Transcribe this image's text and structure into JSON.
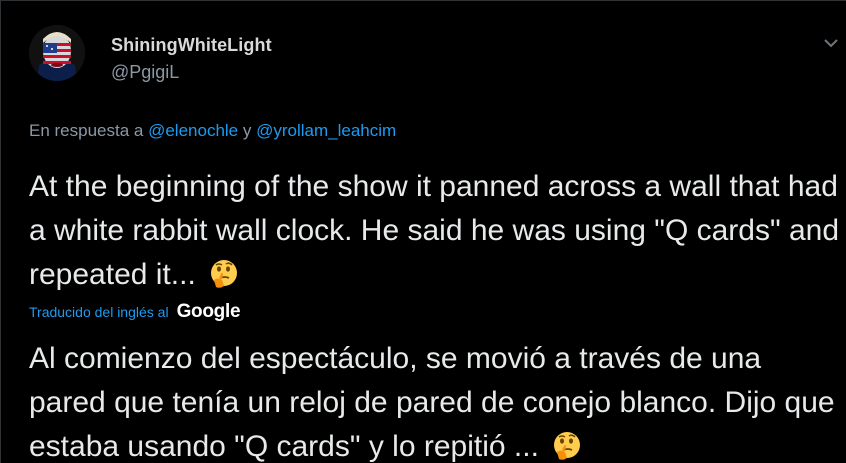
{
  "tweet": {
    "author": {
      "display_name": "ShiningWhiteLight",
      "handle": "@PgigiL"
    },
    "reply_to": {
      "prefix": "En respuesta a",
      "mention_1": "@elenochle",
      "connector": "y",
      "mention_2": "@yrollam_leahcim"
    },
    "original_text": "At the beginning of the show it panned across a wall that had a white rabbit wall clock. He said he was using \"Q cards\" and repeated it...",
    "translation_label": "Traducido del inglés al",
    "translation_provider": "Google",
    "translated_text": "Al comienzo del espectáculo, se movió a través de una pared que tenía un reloj de pared de conejo blanco. Dijo que estaba usando \"Q cards\" y lo repitió ...",
    "emoji": "thinking-face-icon"
  },
  "colors": {
    "background": "#000000",
    "link": "#1d9bf0",
    "secondary_text": "#8b98a5",
    "primary_text": "#e7e9ea"
  }
}
